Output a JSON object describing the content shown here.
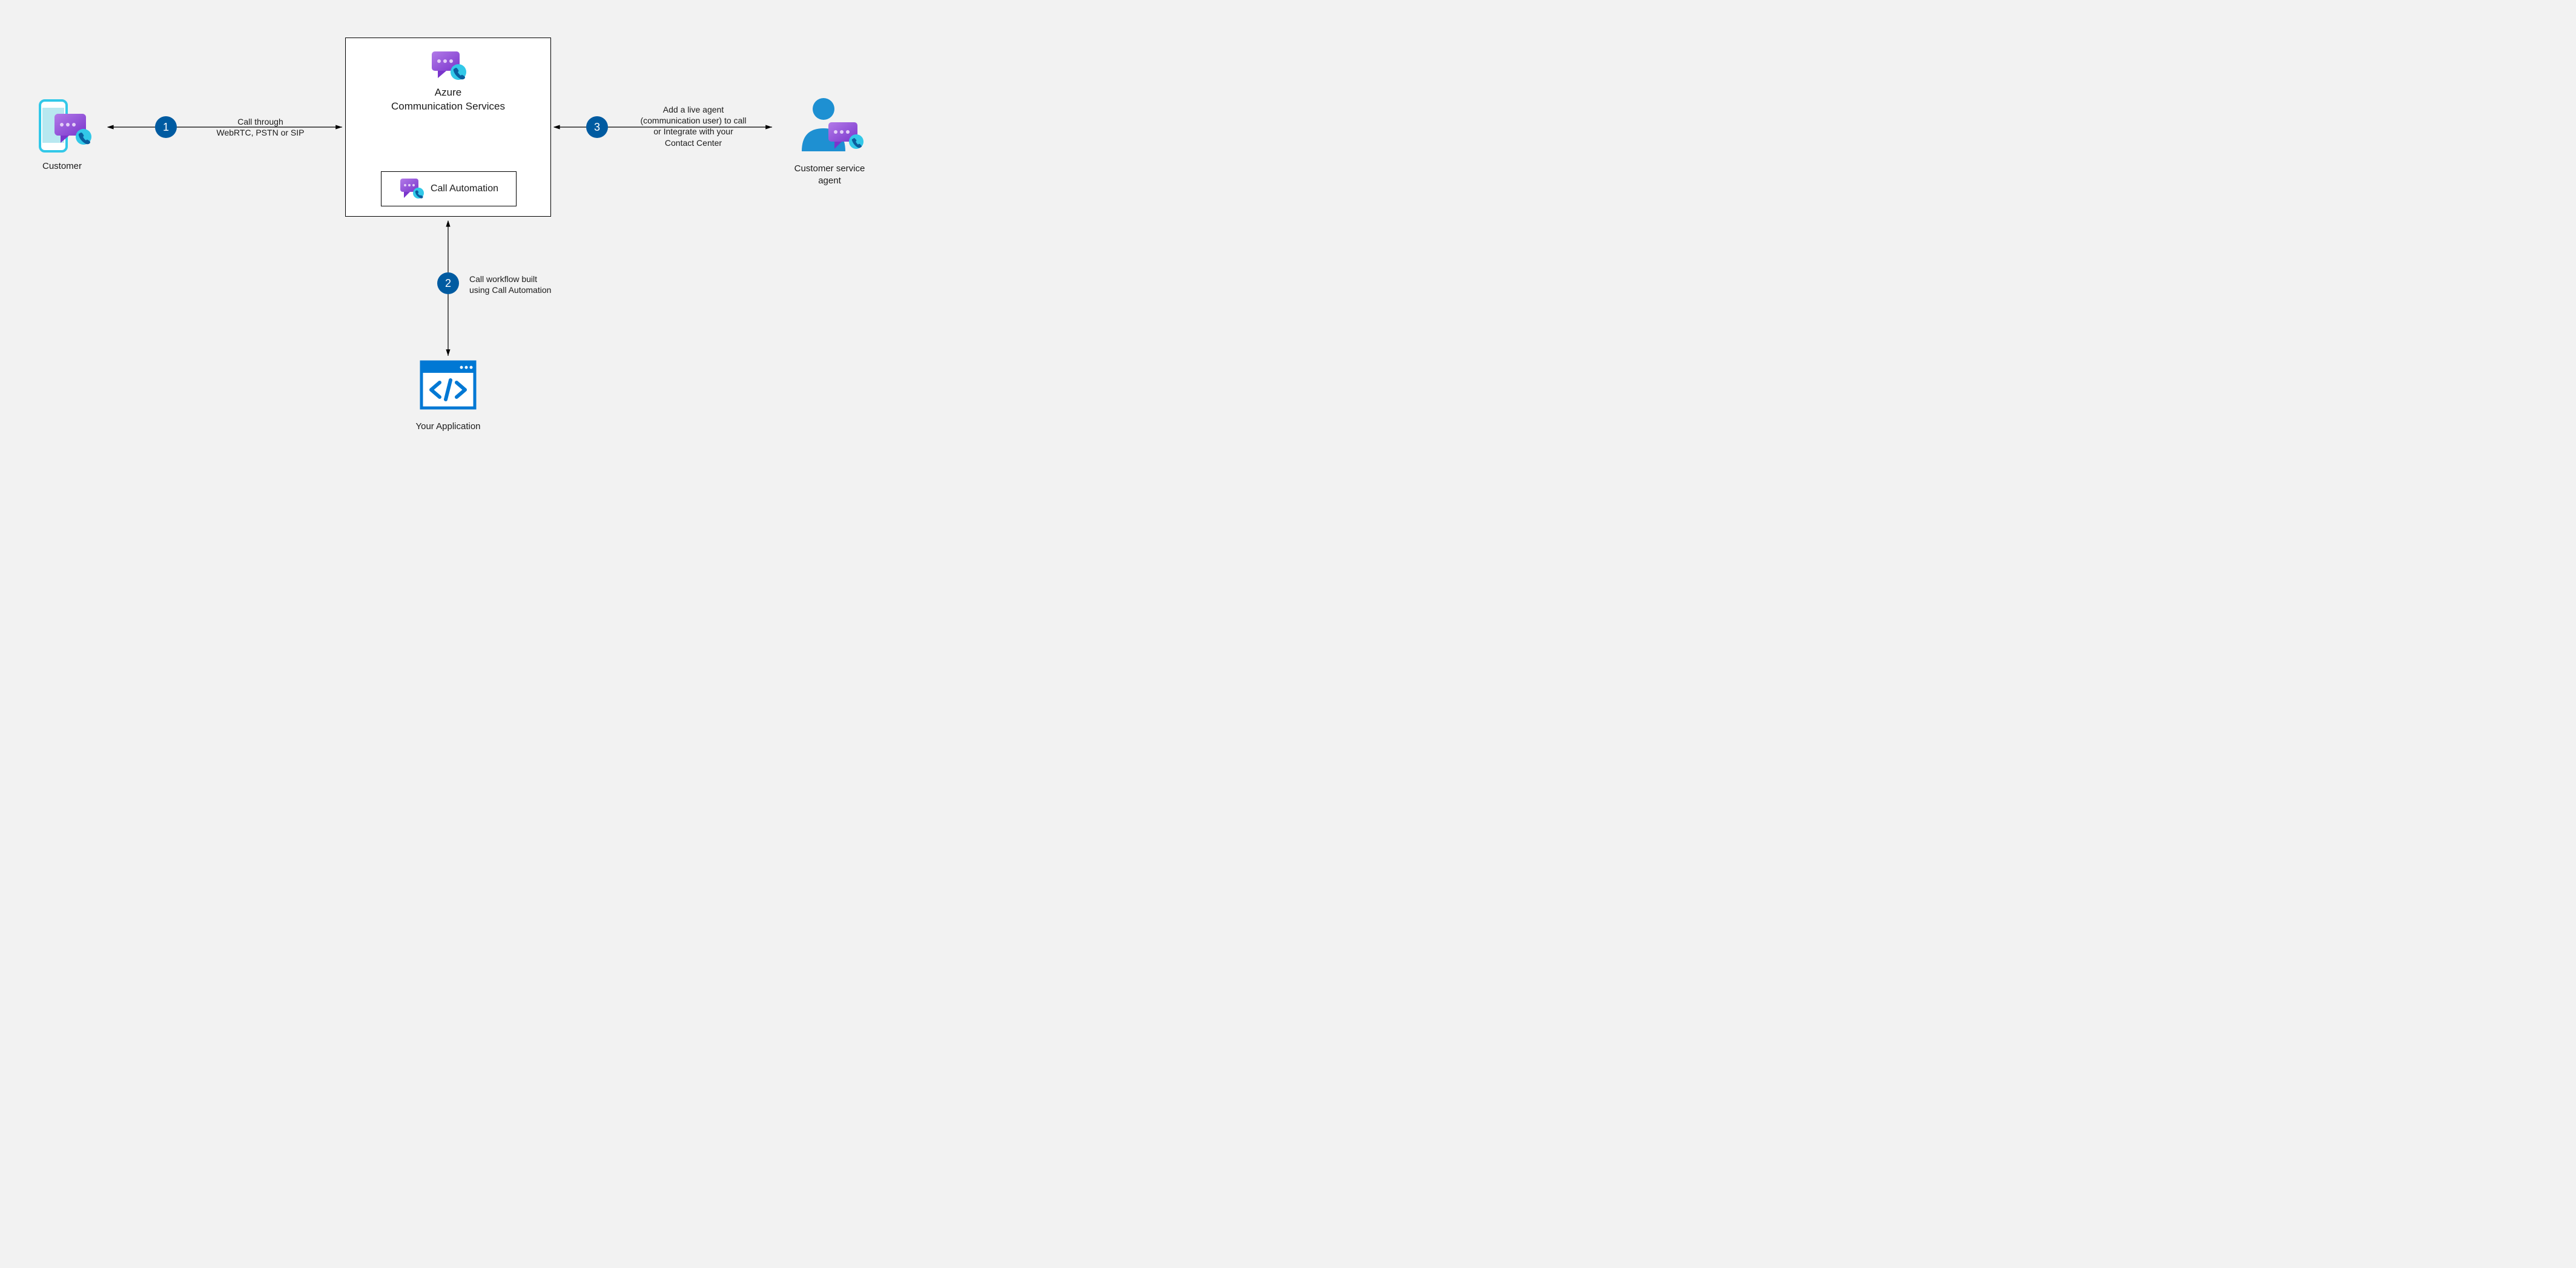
{
  "nodes": {
    "customer": {
      "label": "Customer"
    },
    "acs": {
      "title_line1": "Azure",
      "title_line2": "Communication Services",
      "call_automation": "Call Automation"
    },
    "your_app": {
      "label": "Your Application"
    },
    "agent": {
      "line1": "Customer service",
      "line2": "agent"
    }
  },
  "edges": {
    "e1": {
      "num": "1",
      "line1": "Call through",
      "line2": "WebRTC, PSTN or SIP"
    },
    "e2": {
      "num": "2",
      "line1": "Call workflow built",
      "line2": "using Call Automation"
    },
    "e3": {
      "num": "3",
      "line1": "Add a live agent",
      "line2": "(communication user) to call",
      "line3": "or Integrate with your",
      "line4": "Contact Center"
    }
  },
  "colors": {
    "badge": "#005ba1",
    "azure_blue": "#0078D4",
    "azure_cyan": "#32C8E8",
    "purple_dark": "#7A35CC",
    "purple_light": "#B27AE8"
  }
}
